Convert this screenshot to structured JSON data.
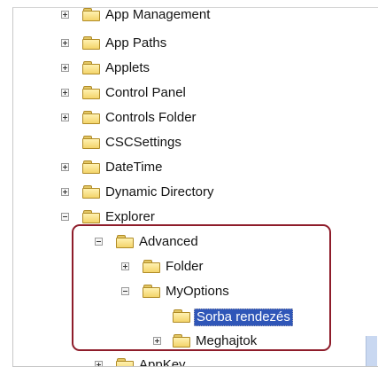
{
  "tree": {
    "items": [
      {
        "label": "App Management",
        "expander": "plus"
      },
      {
        "label": "App Paths",
        "expander": "plus"
      },
      {
        "label": "Applets",
        "expander": "plus"
      },
      {
        "label": "Control Panel",
        "expander": "plus"
      },
      {
        "label": "Controls Folder",
        "expander": "plus"
      },
      {
        "label": "CSCSettings",
        "expander": "none"
      },
      {
        "label": "DateTime",
        "expander": "plus"
      },
      {
        "label": "Dynamic Directory",
        "expander": "plus"
      },
      {
        "label": "Explorer",
        "expander": "minus"
      },
      {
        "label": "Advanced",
        "expander": "minus"
      },
      {
        "label": "Folder",
        "expander": "plus"
      },
      {
        "label": "MyOptions",
        "expander": "minus"
      },
      {
        "label": "Sorba rendezés",
        "expander": "none",
        "selected": true
      },
      {
        "label": "Meghajtok",
        "expander": "plus"
      },
      {
        "label": "AppKey",
        "expander": "plus"
      }
    ]
  },
  "colors": {
    "highlight_border": "#8e1c2a",
    "selection": "#2f56b8"
  }
}
